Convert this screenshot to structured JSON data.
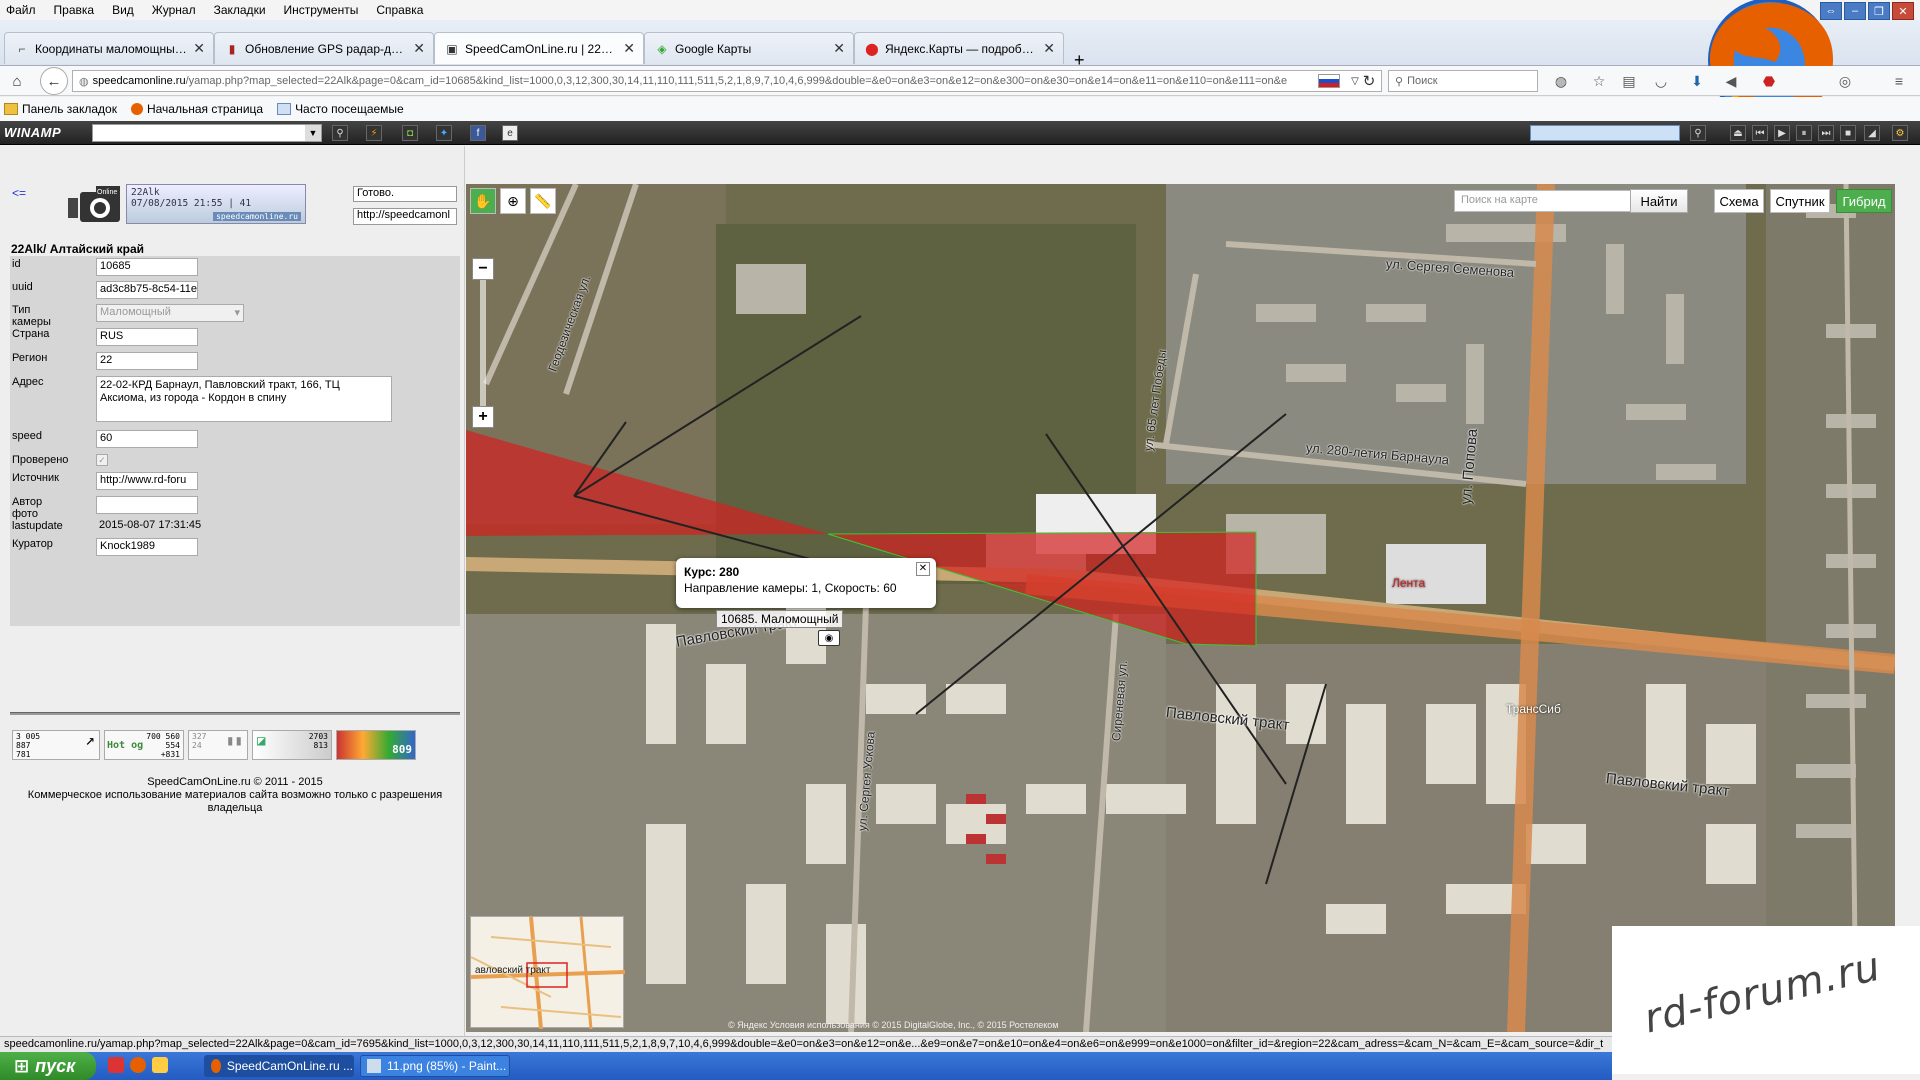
{
  "menu": [
    "Файл",
    "Правка",
    "Вид",
    "Журнал",
    "Закладки",
    "Инструменты",
    "Справка"
  ],
  "tabs": [
    {
      "label": "Координаты маломощных р...",
      "icon": "rd-forum-icon"
    },
    {
      "label": "Обновление GPS радар-дет...",
      "icon": "radar-icon"
    },
    {
      "label": "SpeedCamOnLine.ru | 22Alk |...",
      "icon": "speedcam-icon",
      "active": true
    },
    {
      "label": "Google Карты",
      "icon": "google-maps-icon"
    },
    {
      "label": "Яндекс.Карты — подробна...",
      "icon": "yandex-maps-icon"
    }
  ],
  "nav": {
    "url_domain": "speedcamonline.ru",
    "url_rest": "/yamap.php?map_selected=22Alk&page=0&cam_id=10685&kind_list=1000,0,3,12,300,30,14,11,110,111,511,5,2,1,8,9,7,10,4,6,999&double=&e0=on&e3=on&e12=on&e300=on&e30=on&e14=on&e11=on&e110=on&e111=on&e",
    "search_placeholder": "Поиск"
  },
  "bookmarks": [
    "Панель закладок",
    "Начальная страница",
    "Часто посещаемые"
  ],
  "winamp": {
    "logo": "WINAMP"
  },
  "left": {
    "back": "<=",
    "logo_line1": "22Alk",
    "logo_line2": "07/08/2015 21:55 | 41",
    "logo_line3": "speedcamonline.ru",
    "status_ready": "Готово.",
    "status_url": "http://speedcamonl",
    "region_title": "22Alk/ Алтайский край",
    "fields": {
      "id_label": "id",
      "id": "10685",
      "uuid_label": "uuid",
      "uuid": "ad3c8b75-8c54-11e",
      "type_label": "Тип камеры",
      "type": "Маломощный",
      "country_label": "Страна",
      "country": "RUS",
      "region_label": "Регион",
      "region": "22",
      "address_label": "Адрес",
      "address": "22-02-КРД Барнаул, Павловский тракт, 166, ТЦ Аксиома, из города - Кордон в спину",
      "speed_label": "speed",
      "speed": "60",
      "verified_label": "Проверено",
      "source_label": "Источник",
      "source": "http://www.rd-foru",
      "photo_label": "Автор фото",
      "photo": "",
      "lastupdate_label": "lastupdate",
      "lastupdate": "2015-08-07 17:31:45",
      "curator_label": "Куратор",
      "curator": "Knock1989"
    },
    "counters": {
      "c1": "3 005\n887\n781",
      "c2_title": "Hot og",
      "c2": "700 560\n554\n+831",
      "c3": "327\n24",
      "c4": "2703\n813",
      "c5": "809"
    },
    "copyright_1": "SpeedCamOnLine.ru © 2011 - 2015",
    "copyright_2": "Коммерческое использование материалов сайта возможно только с разрешения владельца"
  },
  "map": {
    "search_placeholder": "Поиск на карте",
    "find": "Найти",
    "scheme": "Схема",
    "satellite": "Спутник",
    "hybrid": "Гибрид",
    "popup_title": "Курс: 280",
    "popup_text": "Направление камеры: 1, Скорость: 60",
    "cam_label": "10685. Маломощный",
    "streets": {
      "pavlovsky1": "Павловский тракт",
      "pavlovsky2": "Павловский тракт",
      "pavlovsky3": "Павловский тракт",
      "semenova": "ул. Сергея Семенова",
      "barnaul280": "ул. 280-летия Барнаула",
      "popova": "ул. Попова",
      "pobedy": "ул. 65 лет Победы",
      "geodez": "Геодезическая ул.",
      "sirenevaya": "Сиреневая ул.",
      "sergeya": "ул. Сергея Ускова"
    },
    "pois": {
      "lenta": "Лента",
      "transsib": "ТрансСиб"
    },
    "minimap_label": "авловский тракт",
    "copyright": "© Яндекс  Условия использования  © 2015 DigitalGlobe, Inc., © 2015 Ростелеком"
  },
  "watermark": "rd-forum.ru",
  "statusbar": "speedcamonline.ru/yamap.php?map_selected=22Alk&page=0&cam_id=7695&kind_list=1000,0,3,12,300,30,14,11,110,111,511,5,2,1,8,9,7,10,4,6,999&double=&e0=on&e3=on&e12=on&e...&e9=on&e7=on&e10=on&e4=on&e6=on&e999=on&e1000=on&filter_id=&region=22&cam_adress=&cam_N=&cam_E=&cam_source=&dir_t",
  "taskbar": {
    "start": "пуск",
    "task1": "SpeedCamOnLine.ru ...",
    "task2": "11.png (85%) - Paint..."
  }
}
